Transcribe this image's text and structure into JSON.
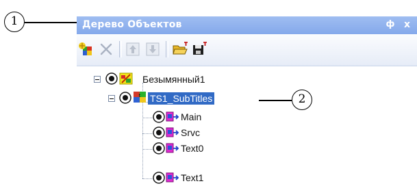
{
  "callouts": {
    "c1": "1",
    "c2": "2"
  },
  "panel": {
    "title": "Дерево Объектов",
    "pin_glyph": "ф",
    "close_glyph": "x"
  },
  "toolbar": {
    "icons": [
      "add-object-icon",
      "delete-icon",
      "move-up-icon",
      "move-down-icon",
      "open-folder-icon",
      "save-icon"
    ]
  },
  "tree": {
    "root": {
      "label": "Безымянный1"
    },
    "group": {
      "label": "TS1_SubTitles"
    },
    "children": [
      {
        "label": "Main"
      },
      {
        "label": "Srvc"
      },
      {
        "label": "Text0"
      },
      {
        "label": "Text1"
      }
    ]
  },
  "colors": {
    "titlebar": "#8fb1ee",
    "selection": "#316ac5"
  }
}
